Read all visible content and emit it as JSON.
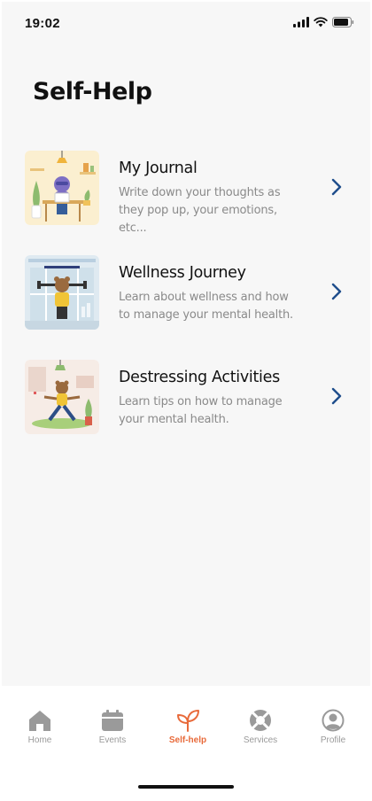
{
  "status": {
    "time": "19:02"
  },
  "page": {
    "title": "Self-Help"
  },
  "cards": [
    {
      "title": "My Journal",
      "description": "Write down your thoughts as they pop up, your emotions, etc..."
    },
    {
      "title": "Wellness Journey",
      "description": "Learn about wellness and how to manage your mental health."
    },
    {
      "title": "Destressing Activities",
      "description": "Learn tips on how to manage your mental health."
    }
  ],
  "tabs": [
    {
      "label": "Home",
      "icon": "home-icon"
    },
    {
      "label": "Events",
      "icon": "calendar-icon"
    },
    {
      "label": "Self-help",
      "icon": "sprout-icon",
      "active": true
    },
    {
      "label": "Services",
      "icon": "lifebuoy-icon"
    },
    {
      "label": "Profile",
      "icon": "profile-icon"
    }
  ],
  "colors": {
    "accent": "#e86a3a",
    "chevron": "#1f4e8c",
    "inactive_tab": "#9a9a9a"
  }
}
